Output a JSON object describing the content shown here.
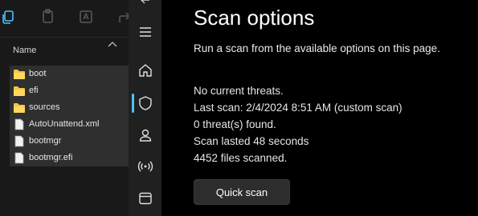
{
  "explorer": {
    "column_header": "Name",
    "items": [
      {
        "name": "boot",
        "type": "folder"
      },
      {
        "name": "efi",
        "type": "folder"
      },
      {
        "name": "sources",
        "type": "folder"
      },
      {
        "name": "AutoUnattend.xml",
        "type": "file"
      },
      {
        "name": "bootmgr",
        "type": "file"
      },
      {
        "name": "bootmgr.efi",
        "type": "file"
      }
    ]
  },
  "rail": {
    "items": [
      "menu-icon",
      "home-icon",
      "shield-icon",
      "account-icon",
      "wireless-icon",
      "app-browser-icon"
    ],
    "active": "shield-icon",
    "accent": "#4cc2ff"
  },
  "main": {
    "title": "Scan options",
    "subtitle": "Run a scan from the available options on this page.",
    "status": {
      "threats": "No current threats.",
      "last_scan": "Last scan: 2/4/2024 8:51 AM (custom scan)",
      "found": "0 threat(s) found.",
      "duration": "Scan lasted 48 seconds",
      "files": "4452 files scanned."
    },
    "quick_scan_label": "Quick scan"
  }
}
